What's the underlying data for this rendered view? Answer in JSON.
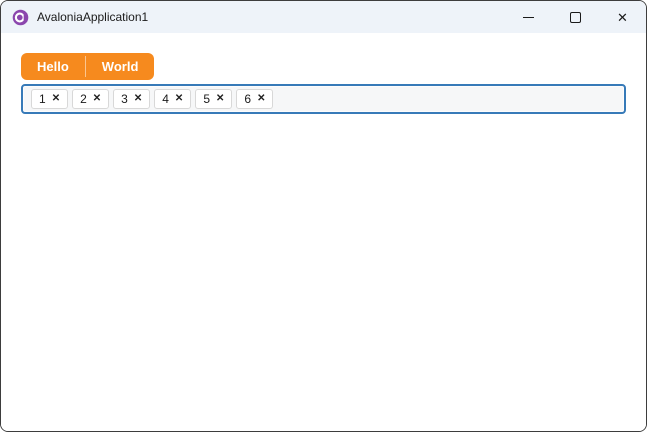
{
  "window": {
    "title": "AvaloniaApplication1",
    "icons": {
      "app_logo": "avalonia-logo",
      "minimize": "minimize-icon",
      "maximize": "maximize-icon",
      "close_glyph": "✕"
    }
  },
  "tabs": [
    {
      "label": "Hello"
    },
    {
      "label": "World"
    }
  ],
  "tagbox": {
    "remove_glyph": "✕",
    "tags": [
      {
        "label": "1"
      },
      {
        "label": "2"
      },
      {
        "label": "3"
      },
      {
        "label": "4"
      },
      {
        "label": "5"
      },
      {
        "label": "6"
      }
    ]
  },
  "colors": {
    "accent_orange": "#F68A1E",
    "focus_border_blue": "#377AB8",
    "titlebar_bg": "#EEF3F9",
    "logo_purple": "#8B46AD",
    "window_border": "#3D3D3D"
  }
}
